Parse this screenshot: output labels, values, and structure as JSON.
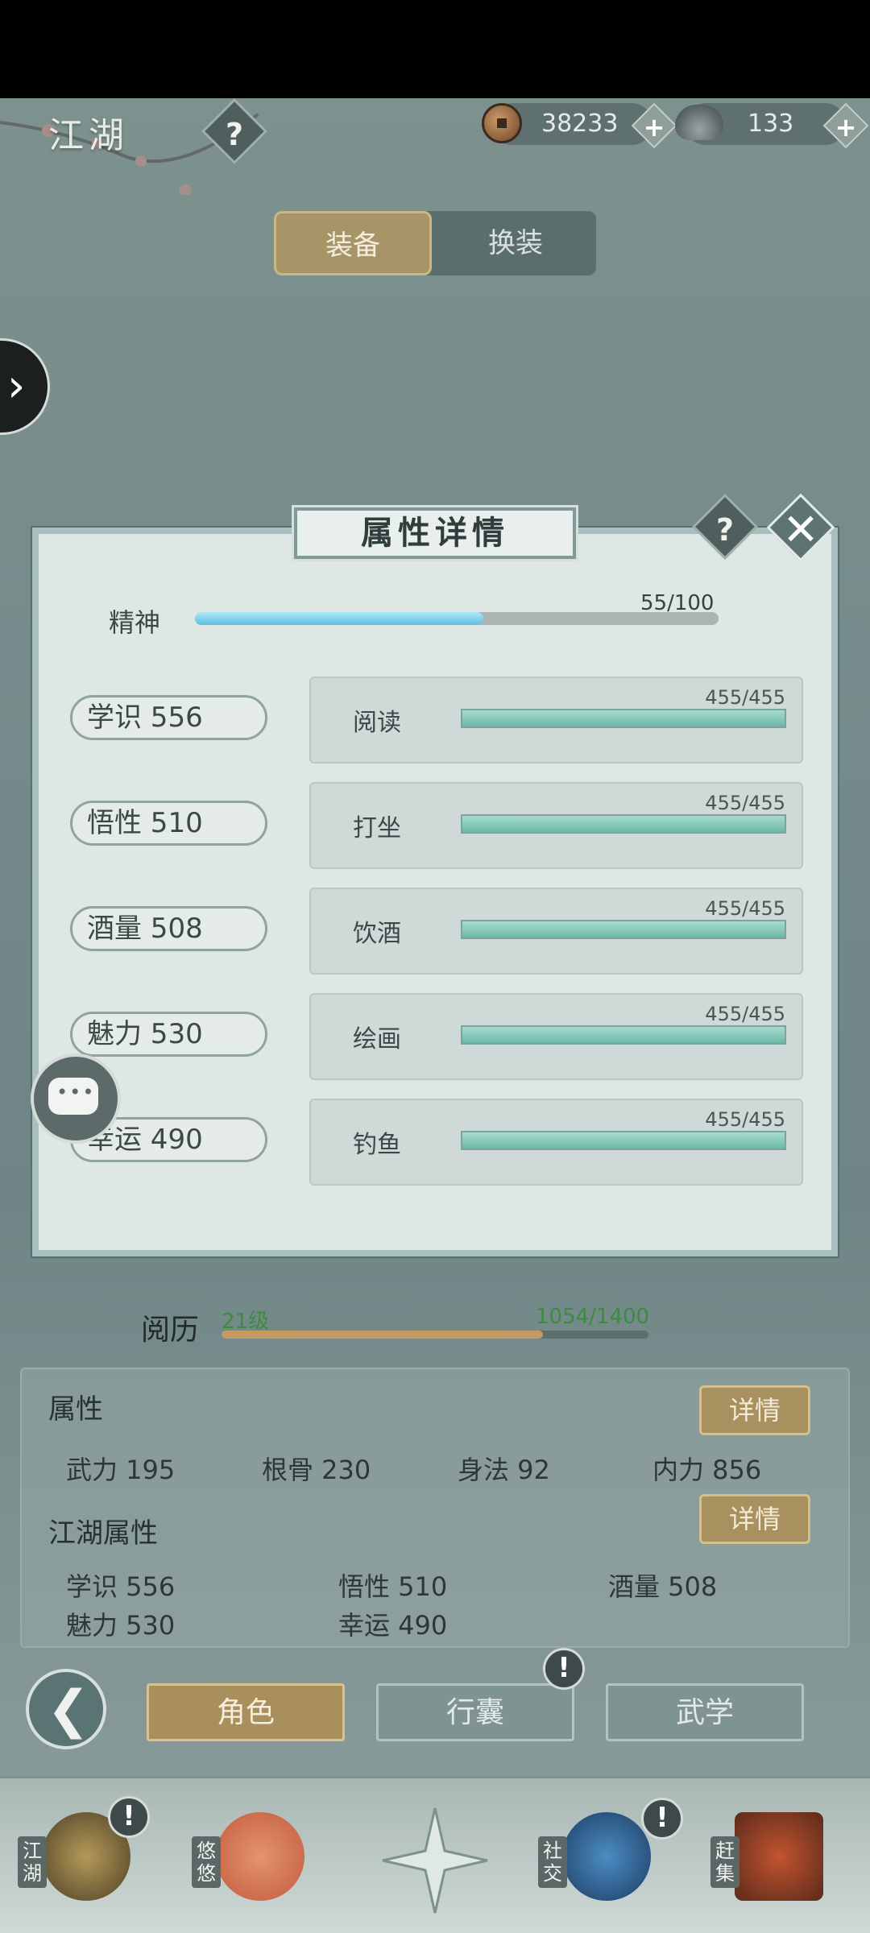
{
  "header": {
    "logo_text": "江湖",
    "help_label": "?",
    "copper_coins": "38233",
    "silver_ingots": "133",
    "add_label": "+"
  },
  "tabs": [
    {
      "label": "装备",
      "active": true
    },
    {
      "label": "换装",
      "active": false
    }
  ],
  "modal": {
    "title": "属性详情",
    "help_label": "?",
    "close_label": "✕",
    "spirit": {
      "label": "精神",
      "value_text": "55/100",
      "fraction": 0.55
    },
    "attributes": [
      {
        "label": "学识 556",
        "skill": "阅读",
        "skill_value": "455/455",
        "fraction": 1.0
      },
      {
        "label": "悟性 510",
        "skill": "打坐",
        "skill_value": "455/455",
        "fraction": 1.0
      },
      {
        "label": "酒量 508",
        "skill": "饮酒",
        "skill_value": "455/455",
        "fraction": 1.0
      },
      {
        "label": "魅力 530",
        "skill": "绘画",
        "skill_value": "455/455",
        "fraction": 1.0
      },
      {
        "label": "幸运 490",
        "skill": "钓鱼",
        "skill_value": "455/455",
        "fraction": 1.0
      }
    ]
  },
  "experience": {
    "label": "阅历",
    "level": "21级",
    "value_text": "1054/1400",
    "fraction": 0.753
  },
  "attributes_panel": {
    "title": "属性",
    "detail_label": "详情",
    "stats": [
      "武力 195",
      "根骨 230",
      "身法 92",
      "内力 856"
    ]
  },
  "jianghu_panel": {
    "title": "江湖属性",
    "detail_label": "详情",
    "stats": [
      "学识 556",
      "悟性 510",
      "酒量 508",
      "魅力 530",
      "幸运 490"
    ]
  },
  "nav": {
    "back_label": "❮",
    "tabs": [
      {
        "label": "角色",
        "active": true
      },
      {
        "label": "行囊",
        "active": false,
        "alert": "!"
      },
      {
        "label": "武学",
        "active": false
      }
    ]
  },
  "dock": [
    {
      "label": "江湖",
      "alert": "!"
    },
    {
      "label": "悠悠",
      "alert": ""
    },
    {
      "label": "",
      "alert": ""
    },
    {
      "label": "社交",
      "alert": "!"
    },
    {
      "label": "赶集",
      "alert": ""
    }
  ]
}
